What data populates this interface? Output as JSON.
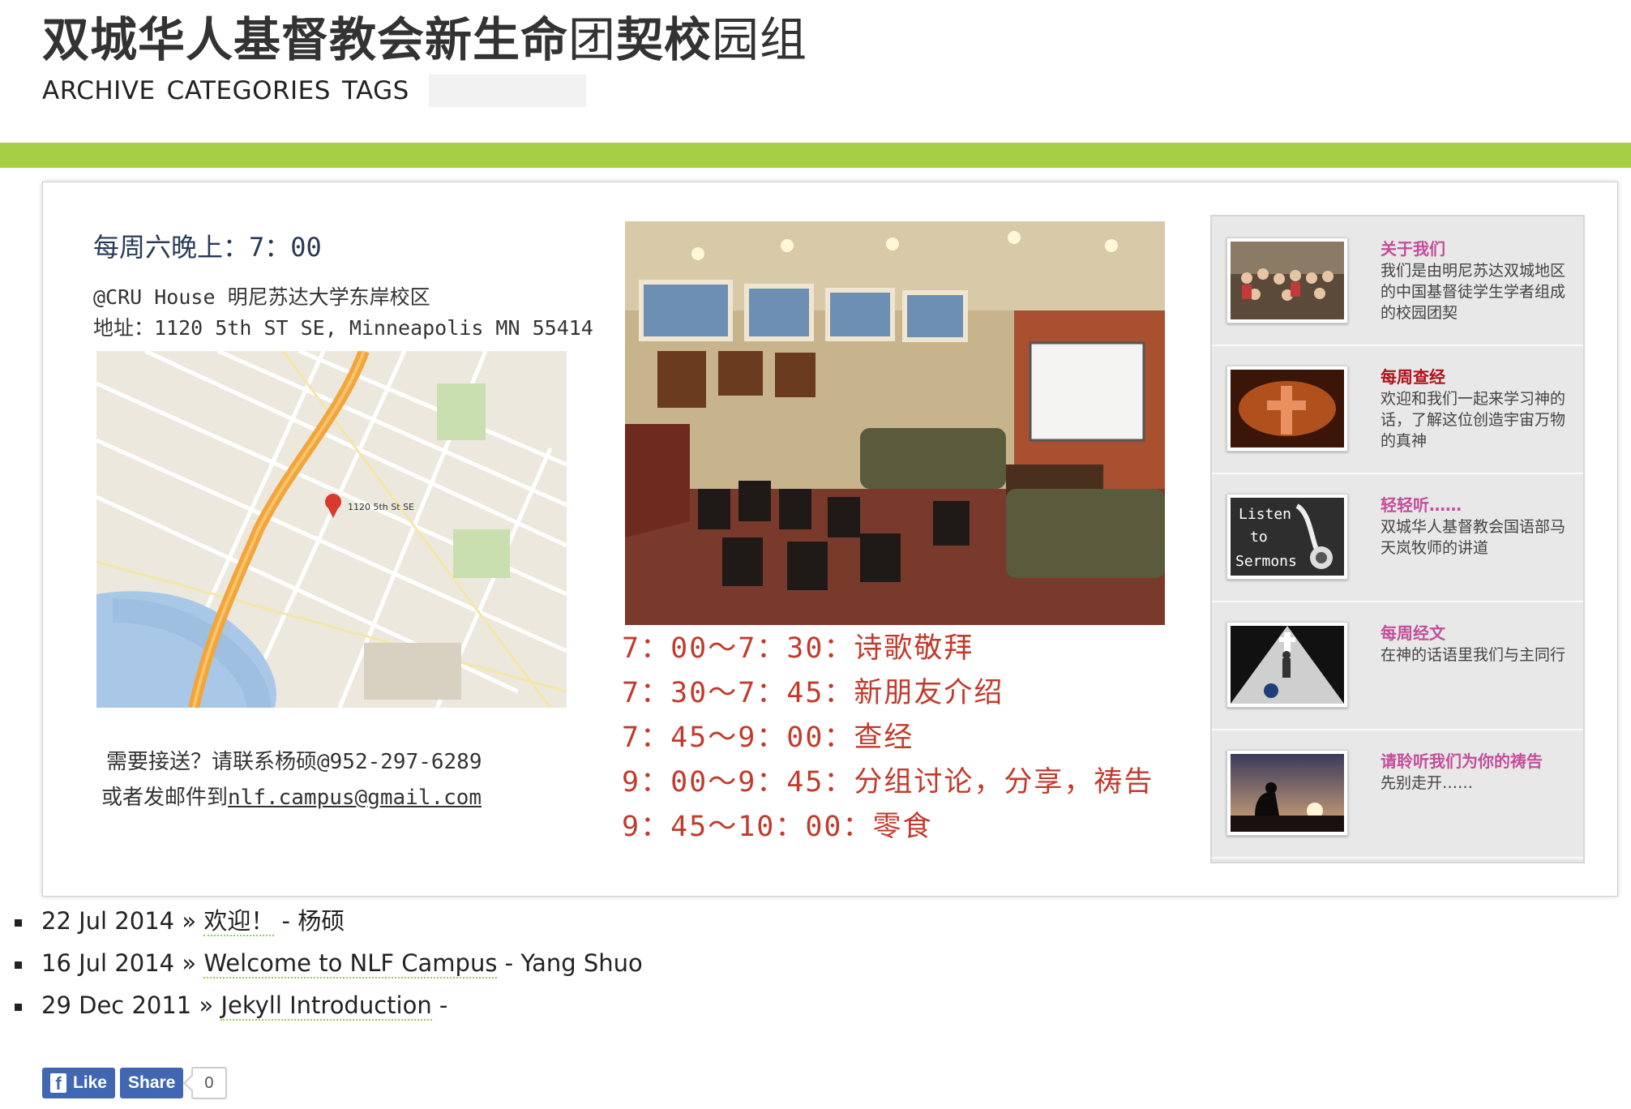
{
  "site": {
    "title_bold_1": "双城华人基督教会新生命",
    "title_light": "团",
    "title_bold_2": "契校",
    "title_light_2": "园组"
  },
  "nav": {
    "archive": "ARCHIVE",
    "categories": "CATEGORIES",
    "tags": "TAGS",
    "search_value": ""
  },
  "colors": {
    "green_bar": "#a7cf43",
    "schedule_red": "#c23a2c",
    "sidebar_title": "#c44d9a"
  },
  "banner": {
    "time": "每周六晚上：7：00",
    "location": "@CRU House 明尼苏达大学东岸校区",
    "address": "地址：1120 5th ST SE, Minneapolis MN 55414",
    "map_pin_label": "1120 5th St SE",
    "contact_line1": "需要接送？请联系杨硕@952-297-6289",
    "contact_prefix": "或者发邮件到",
    "contact_email": "nlf.campus@gmail.com",
    "schedule": [
      "7：00～7：30：诗歌敬拜",
      "7：30～7：45：新朋友介绍",
      "7：45～9：00：查经",
      "9：00～9：45：分组讨论，分享，祷告",
      "9：45～10：00：零食"
    ]
  },
  "sidebar": [
    {
      "title": "关于我们",
      "desc": "我们是由明尼苏达双城地区的中国基督徒学生学者组成的校园团契",
      "icon": "group-photo"
    },
    {
      "title": "每周查经",
      "desc": "欢迎和我们一起来学习神的话，了解这位创造宇宙万物的真神",
      "icon": "bible-cross"
    },
    {
      "title": "轻轻听……",
      "desc": "双城华人基督教会国语部马天岚牧师的讲道",
      "icon": "earphones",
      "thumb_text": [
        "Listen",
        "to",
        "Sermons"
      ]
    },
    {
      "title": "每周经文",
      "desc": "在神的话语里我们与主同行",
      "icon": "walking-cross"
    },
    {
      "title": "请聆听我们为你的祷告",
      "desc": "先别走开……",
      "icon": "praying-sunset"
    }
  ],
  "posts": [
    {
      "date": "22 Jul 2014",
      "sep": " » ",
      "title": "欢迎！",
      "author": " - 杨硕"
    },
    {
      "date": "16 Jul 2014",
      "sep": " » ",
      "title": "Welcome to NLF Campus",
      "author": " - Yang Shuo"
    },
    {
      "date": "29 Dec 2011",
      "sep": " » ",
      "title": "Jekyll Introduction",
      "author": " -"
    }
  ],
  "facebook": {
    "like": "Like",
    "share": "Share",
    "count": "0"
  }
}
